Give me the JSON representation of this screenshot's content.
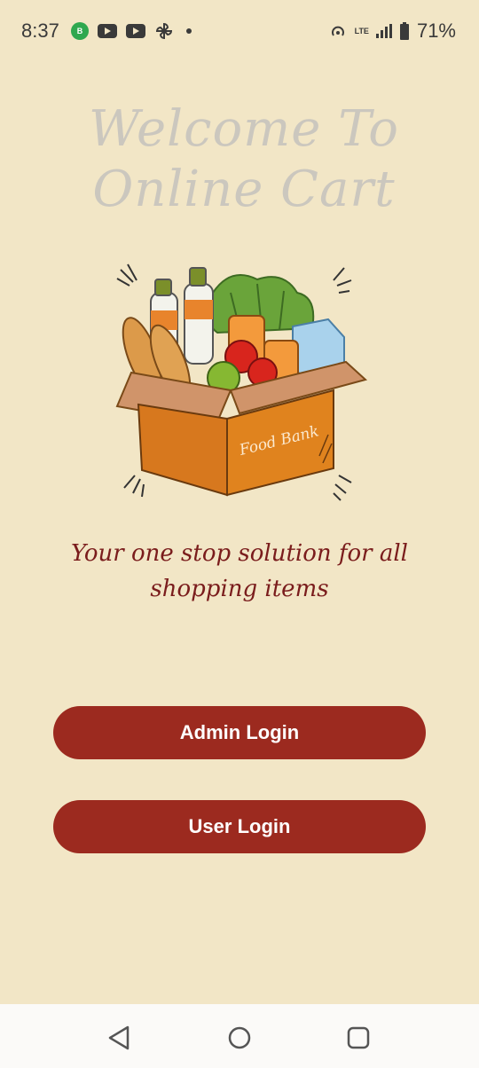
{
  "status_bar": {
    "time": "8:37",
    "app_badge": "B",
    "network": "LTE",
    "battery": "71%"
  },
  "title": "Welcome To Online Cart",
  "illustration": {
    "box_label": "Food Bank"
  },
  "tagline": "Your one stop solution for all shopping items",
  "buttons": {
    "admin": "Admin Login",
    "user": "User Login"
  },
  "colors": {
    "background": "#f2e6c6",
    "button": "#9c2a1f",
    "tagline": "#7a1c1c",
    "title": "#cbc7be"
  },
  "nav_bar": {
    "icons": [
      "back-icon",
      "home-icon",
      "recents-icon"
    ]
  }
}
